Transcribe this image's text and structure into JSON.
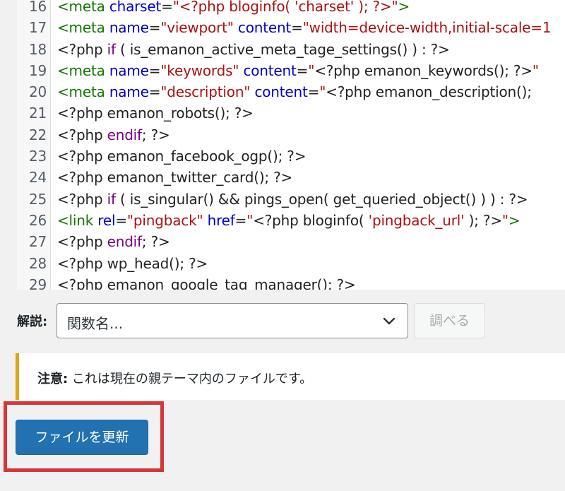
{
  "editor": {
    "lines": [
      {
        "num": "16",
        "tokens": [
          {
            "t": "<meta ",
            "c": "t-tag"
          },
          {
            "t": "charset",
            "c": "t-attr"
          },
          {
            "t": "=",
            "c": ""
          },
          {
            "t": "\"<?php bloginfo( 'charset' ); ?>\"",
            "c": "t-str"
          },
          {
            "t": ">",
            "c": "t-tag"
          }
        ]
      },
      {
        "num": "17",
        "tokens": [
          {
            "t": "<meta ",
            "c": "t-tag"
          },
          {
            "t": "name",
            "c": "t-attr"
          },
          {
            "t": "=",
            "c": ""
          },
          {
            "t": "\"viewport\"",
            "c": "t-str"
          },
          {
            "t": " content",
            "c": "t-attr"
          },
          {
            "t": "=",
            "c": ""
          },
          {
            "t": "\"width=device-width,initial-scale=1",
            "c": "t-str"
          }
        ]
      },
      {
        "num": "18",
        "tokens": [
          {
            "t": "<?php ",
            "c": ""
          },
          {
            "t": "if",
            "c": "t-kw"
          },
          {
            "t": " ( is_emanon_active_meta_tage_settings() ) : ?>",
            "c": ""
          }
        ]
      },
      {
        "num": "19",
        "tokens": [
          {
            "t": "<meta ",
            "c": "t-tag"
          },
          {
            "t": "name",
            "c": "t-attr"
          },
          {
            "t": "=",
            "c": ""
          },
          {
            "t": "\"keywords\"",
            "c": "t-str"
          },
          {
            "t": " content",
            "c": "t-attr"
          },
          {
            "t": "=",
            "c": ""
          },
          {
            "t": "\"",
            "c": "t-str"
          },
          {
            "t": "<?php emanon_keywords(); ?>",
            "c": ""
          },
          {
            "t": "\"",
            "c": "t-str"
          }
        ]
      },
      {
        "num": "20",
        "tokens": [
          {
            "t": "<meta ",
            "c": "t-tag"
          },
          {
            "t": "name",
            "c": "t-attr"
          },
          {
            "t": "=",
            "c": ""
          },
          {
            "t": "\"description\"",
            "c": "t-str"
          },
          {
            "t": " content",
            "c": "t-attr"
          },
          {
            "t": "=",
            "c": ""
          },
          {
            "t": "\"",
            "c": "t-str"
          },
          {
            "t": "<?php emanon_description();",
            "c": ""
          }
        ]
      },
      {
        "num": "21",
        "tokens": [
          {
            "t": "<?php emanon_robots(); ?>",
            "c": ""
          }
        ]
      },
      {
        "num": "22",
        "tokens": [
          {
            "t": "<?php ",
            "c": ""
          },
          {
            "t": "endif",
            "c": "t-kw"
          },
          {
            "t": "; ?>",
            "c": ""
          }
        ]
      },
      {
        "num": "23",
        "tokens": [
          {
            "t": "<?php emanon_facebook_ogp(); ?>",
            "c": ""
          }
        ]
      },
      {
        "num": "24",
        "tokens": [
          {
            "t": "<?php emanon_twitter_card(); ?>",
            "c": ""
          }
        ]
      },
      {
        "num": "25",
        "tokens": [
          {
            "t": "<?php ",
            "c": ""
          },
          {
            "t": "if",
            "c": "t-kw"
          },
          {
            "t": " ( is_singular() && pings_open( get_queried_object() ) ) : ?>",
            "c": ""
          }
        ]
      },
      {
        "num": "26",
        "tokens": [
          {
            "t": "<link ",
            "c": "t-tag"
          },
          {
            "t": "rel",
            "c": "t-attr"
          },
          {
            "t": "=",
            "c": ""
          },
          {
            "t": "\"pingback\"",
            "c": "t-str"
          },
          {
            "t": " href",
            "c": "t-attr"
          },
          {
            "t": "=",
            "c": ""
          },
          {
            "t": "\"",
            "c": "t-str"
          },
          {
            "t": "<?php bloginfo( ",
            "c": ""
          },
          {
            "t": "'pingback_url'",
            "c": "t-str"
          },
          {
            "t": " ); ?>",
            "c": ""
          },
          {
            "t": "\"",
            "c": "t-str"
          },
          {
            "t": ">",
            "c": "t-tag"
          }
        ]
      },
      {
        "num": "27",
        "tokens": [
          {
            "t": "<?php ",
            "c": ""
          },
          {
            "t": "endif",
            "c": "t-kw"
          },
          {
            "t": "; ?>",
            "c": ""
          }
        ]
      },
      {
        "num": "28",
        "tokens": [
          {
            "t": "<?php wp_head(); ?>",
            "c": ""
          }
        ]
      },
      {
        "num": "29",
        "tokens": [
          {
            "t": "<?php emanon_google_tag_manager(); ?>",
            "c": ""
          }
        ]
      }
    ]
  },
  "lookup": {
    "label": "解説:",
    "select_value": "関数名...",
    "button_label": "調べる"
  },
  "notice": {
    "strong": "注意:",
    "message": " これは現在の親テーマ内のファイルです。"
  },
  "actions": {
    "update_label": "ファイルを更新"
  },
  "colors": {
    "primary": "#2271b1",
    "highlight": "#d63638",
    "notice_accent": "#dba617"
  }
}
